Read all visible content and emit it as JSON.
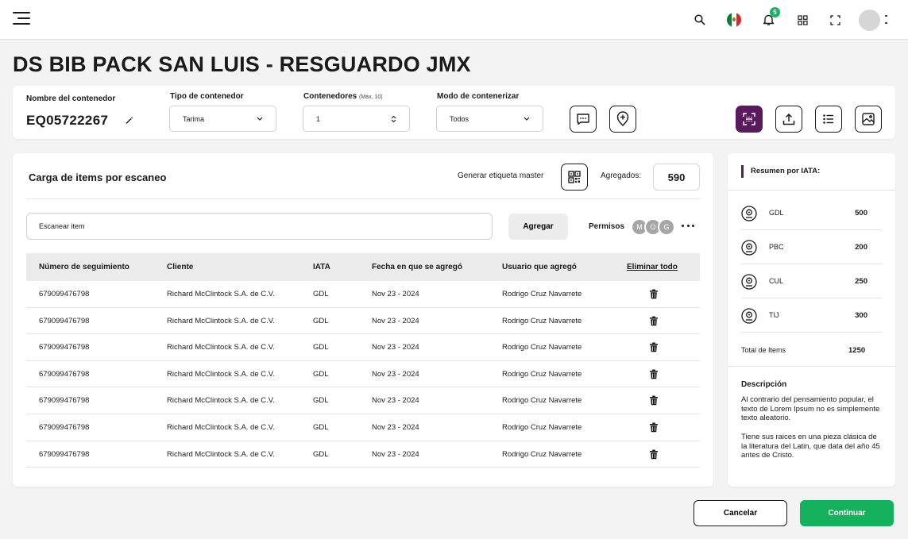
{
  "topbar": {
    "notification_count": "5",
    "icons": [
      "menu-icon",
      "search-icon",
      "mexico-flag-icon",
      "bell-icon",
      "grid-icon",
      "fullscreen-icon",
      "avatar"
    ]
  },
  "page": {
    "title": "DS BIB PACK SAN LUIS - RESGUARDO JMX"
  },
  "container": {
    "name_label": "Nombre del contenedor",
    "name_value": "EQ05722267",
    "type_label": "Tipo de contenedor",
    "type_value": "Tarima",
    "count_label": "Contenedores",
    "count_hint": "(Máx. 10)",
    "count_value": "1",
    "mode_label": "Modo de contenerizar",
    "mode_value": "Todos"
  },
  "scan": {
    "title": "Carga de items por escaneo",
    "generate_label": "Generar etiqueta master",
    "added_label": "Agregados:",
    "added_value": "590",
    "input_placeholder": "Escanear item",
    "add_button": "Agregar",
    "permissions_label": "Permisos",
    "permission_avatars": [
      "M",
      "O",
      "G"
    ]
  },
  "table": {
    "headers": [
      "Número de seguimiento",
      "Cliente",
      "IATA",
      "Fecha en que se agregó",
      "Usuario que agregó",
      "Eliminar todo"
    ],
    "rows": [
      [
        "679099476798",
        "Richard McClintock S.A. de C.V.",
        "GDL",
        "Nov 23 - 2024",
        "Rodrigo Cruz Navarrete"
      ],
      [
        "679099476798",
        "Richard McClintock S.A. de C.V.",
        "GDL",
        "Nov 23 - 2024",
        "Rodrigo Cruz Navarrete"
      ],
      [
        "679099476798",
        "Richard McClintock S.A. de C.V.",
        "GDL",
        "Nov 23 - 2024",
        "Rodrigo Cruz Navarrete"
      ],
      [
        "679099476798",
        "Richard McClintock S.A. de C.V.",
        "GDL",
        "Nov 23 - 2024",
        "Rodrigo Cruz Navarrete"
      ],
      [
        "679099476798",
        "Richard McClintock S.A. de C.V.",
        "GDL",
        "Nov 23 - 2024",
        "Rodrigo Cruz Navarrete"
      ],
      [
        "679099476798",
        "Richard McClintock S.A. de C.V.",
        "GDL",
        "Nov 23 - 2024",
        "Rodrigo Cruz Navarrete"
      ],
      [
        "679099476798",
        "Richard McClintock S.A. de C.V.",
        "GDL",
        "Nov 23 - 2024",
        "Rodrigo Cruz Navarrete"
      ]
    ]
  },
  "summary": {
    "title": "Resumen por IATA:",
    "items": [
      {
        "code": "GDL",
        "value": "500"
      },
      {
        "code": "PBC",
        "value": "200"
      },
      {
        "code": "CUL",
        "value": "250"
      },
      {
        "code": "TIJ",
        "value": "300"
      }
    ],
    "total_label": "Total de Items",
    "total_value": "1250",
    "description_title": "Descripción",
    "description_p1": "Al contrario del pensamiento popular, el texto de Lorem Ipsum no es simplemente texto aleatorio.",
    "description_p2": "Tiene sus raices en una pieza clásica de la literatura del Latin, que data del año 45 antes de Cristo."
  },
  "footer": {
    "cancel_label": "Cancelar",
    "continue_label": "Continuar"
  },
  "colors": {
    "accent_purple": "#5a1b5e",
    "continue_green": "#14b05c",
    "badge_green": "#16b364"
  }
}
